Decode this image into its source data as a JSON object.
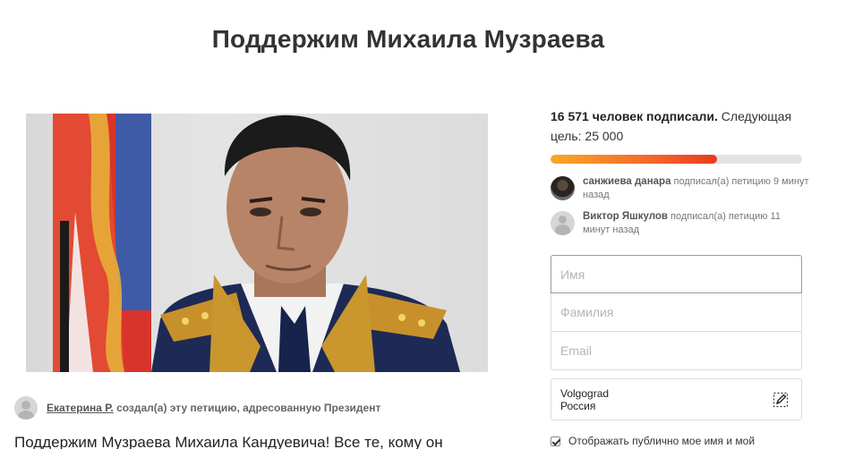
{
  "petition": {
    "title": "Поддержим Михаила Музраева",
    "creator_name": "Екатерина Р.",
    "creator_rest": " создал(а) эту петицию, адресованную Президент",
    "description_start": "Поддержим Музраева Михаила Кандуевича! Все те, кому он"
  },
  "stats": {
    "signed": "16 571 человек подписали.",
    "next_goal": " Следующая цель: 25 000",
    "progress_fraction": 0.6628
  },
  "recent_signers": [
    {
      "name": "санжиева данара",
      "action": " подписал(а) петицию 9 минут назад",
      "avatar": "user-photo"
    },
    {
      "name": "Виктор Яшкулов",
      "action": " подписал(а) петицию 11 минут назад",
      "avatar": "default-user-icon"
    }
  ],
  "form": {
    "first_name_placeholder": "Имя",
    "last_name_placeholder": "Фамилия",
    "email_placeholder": "Email",
    "city": "Volgograd",
    "country": "Россия",
    "edit_icon": "edit-pencil-icon",
    "show_public_label": "Отображать публично мое имя и мой"
  },
  "colors": {
    "progress_start": "#f9a826",
    "progress_end": "#e83a22",
    "progress_track": "#e3e3e3"
  }
}
